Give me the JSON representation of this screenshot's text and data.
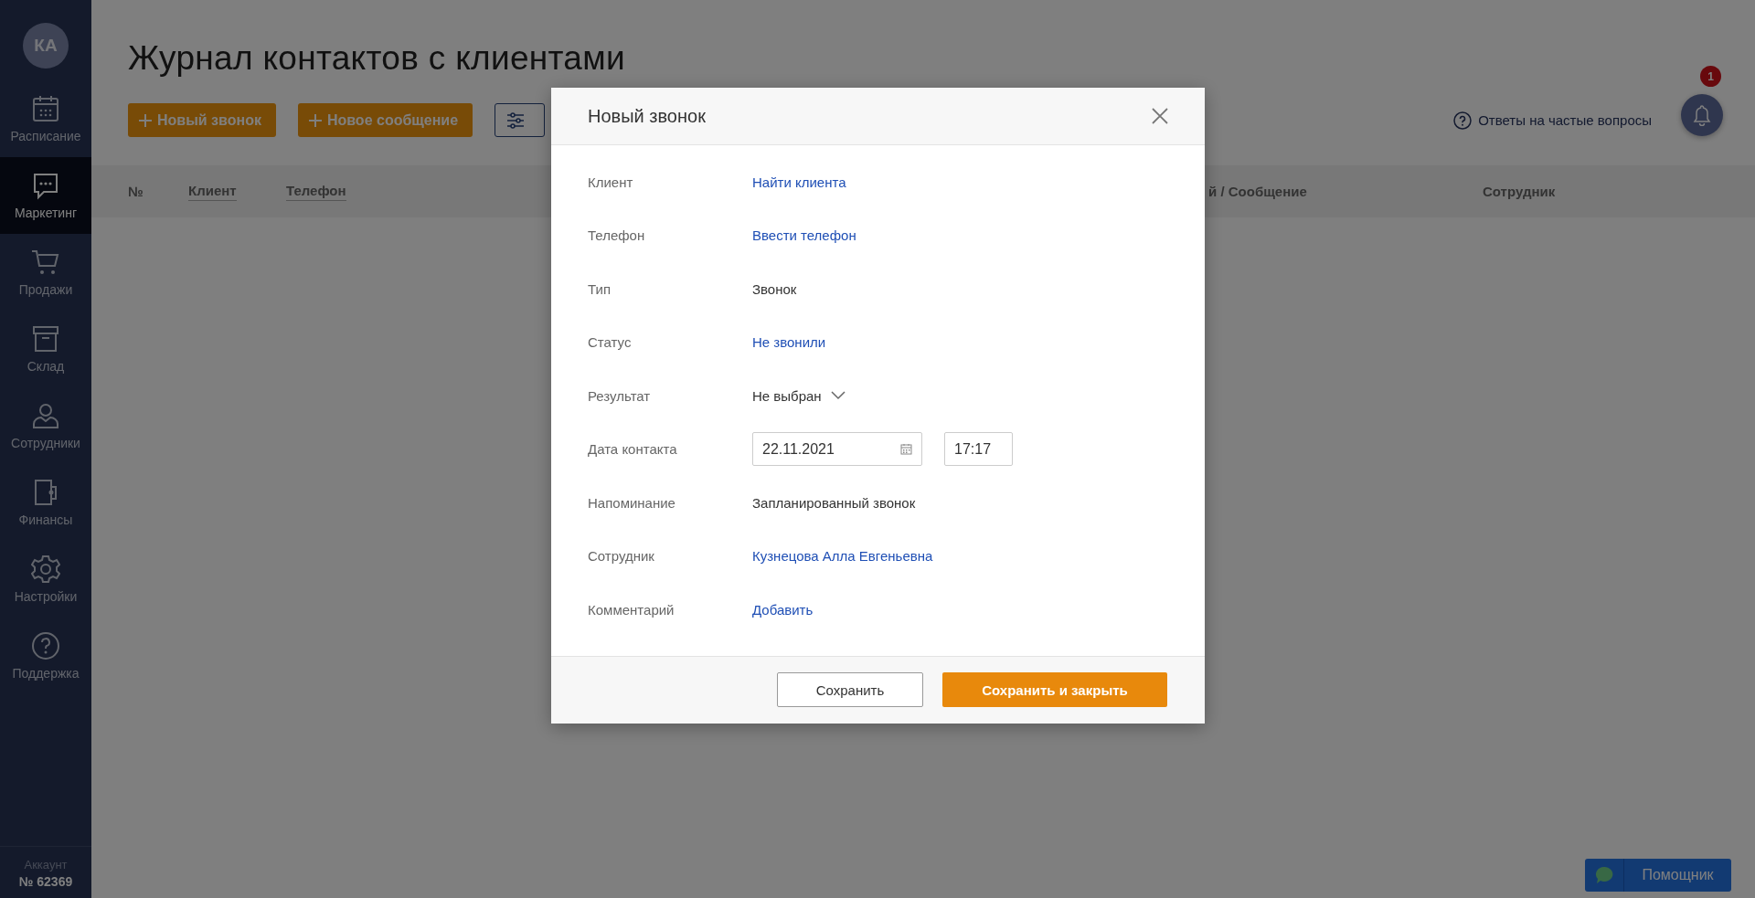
{
  "sidebar": {
    "avatar": "КА",
    "items": [
      {
        "label": "Расписание",
        "selected": false
      },
      {
        "label": "Маркетинг",
        "selected": true
      },
      {
        "label": "Продажи",
        "selected": false
      },
      {
        "label": "Склад",
        "selected": false
      },
      {
        "label": "Сотрудники",
        "selected": false
      },
      {
        "label": "Финансы",
        "selected": false
      },
      {
        "label": "Настройки",
        "selected": false
      },
      {
        "label": "Поддержка",
        "selected": false
      }
    ],
    "account": {
      "label": "Аккаунт",
      "number": "№ 62369"
    }
  },
  "page": {
    "title": "Журнал контактов с клиентами",
    "buttons": [
      "Новый звонок",
      "Новое сообщение"
    ],
    "faq_link": "Ответы на частые вопросы",
    "notifications": "1"
  },
  "table": {
    "columns": [
      {
        "label": "№",
        "sortable": false
      },
      {
        "label": "Клиент",
        "sortable": true
      },
      {
        "label": "Телефон",
        "sortable": true
      },
      {
        "label": "й / Сообщение",
        "sortable": false
      },
      {
        "label": "Сотрудник",
        "sortable": false
      }
    ]
  },
  "modal": {
    "title": "Новый звонок",
    "fields": [
      {
        "label": "Клиент",
        "kind": "link",
        "value": "Найти клиента"
      },
      {
        "label": "Телефон",
        "kind": "link",
        "value": "Ввести телефон"
      },
      {
        "label": "Тип",
        "kind": "text",
        "value": "Звонок"
      },
      {
        "label": "Статус",
        "kind": "link",
        "value": "Не звонили"
      },
      {
        "label": "Результат",
        "kind": "dropdown",
        "value": "Не выбран"
      },
      {
        "label": "Дата контакта",
        "kind": "datetime",
        "date": "22.11.2021",
        "time": "17:17"
      },
      {
        "label": "Напоминание",
        "kind": "text",
        "value": "Запланированный звонок"
      },
      {
        "label": "Сотрудник",
        "kind": "link",
        "value": "Кузнецова Алла Евгеньевна"
      },
      {
        "label": "Комментарий",
        "kind": "link",
        "value": "Добавить"
      }
    ],
    "buttons": [
      {
        "label": "Сохранить",
        "kind": "secondary"
      },
      {
        "label": "Сохранить и закрыть",
        "kind": "primary"
      }
    ]
  },
  "helper": {
    "label": "Помощник"
  }
}
